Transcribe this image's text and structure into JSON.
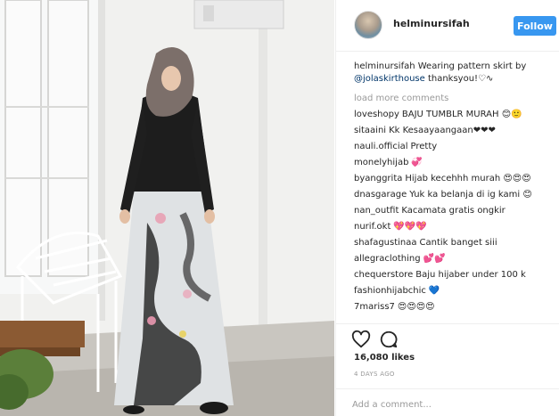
{
  "post": {
    "username": "helminursifah",
    "follow_label": "Follow",
    "caption": {
      "user": "helminursifah",
      "text_before": " Wearing pattern skirt by",
      "mention": "@jolaskirthouse",
      "text_after": " thanksyou!♡∿"
    },
    "load_more_label": "load more comments",
    "comments": [
      {
        "user": "loveshopy",
        "text": "BAJU TUMBLR MURAH 😊🙂"
      },
      {
        "user": "sitaaini",
        "text": "Kk Kesaayaangaan❤❤❤"
      },
      {
        "user": "nauli.official",
        "text": "Pretty"
      },
      {
        "user": "monelyhijab",
        "text": "💞"
      },
      {
        "user": "byanggrita",
        "text": "Hijab kecehhh murah 😍😍😍"
      },
      {
        "user": "dnasgarage",
        "text": "Yuk ka belanja di ig kami 😊"
      },
      {
        "user": "nan_outfit",
        "text": "Kacamata gratis ongkir"
      },
      {
        "user": "nurif.okt",
        "text": "💖💖💖"
      },
      {
        "user": "shafagustinaa",
        "text": "Cantik banget siii"
      },
      {
        "user": "allegraclothing",
        "text": "💕💕"
      },
      {
        "user": "chequerstore",
        "text": "Baju hijaber under 100 k"
      },
      {
        "user": "fashionhijabchic",
        "text": "💙"
      },
      {
        "user": "7mariss7",
        "text": "😍😍😍😍"
      }
    ],
    "likes": "16,080 likes",
    "timestamp": "4 DAYS AGO",
    "add_comment_placeholder": "Add a comment..."
  },
  "icons": {
    "like": "heart-icon",
    "comment": "comment-bubble-icon"
  },
  "colors": {
    "follow_button": "#3897f0",
    "mention": "#003569",
    "muted_text": "#999999"
  }
}
